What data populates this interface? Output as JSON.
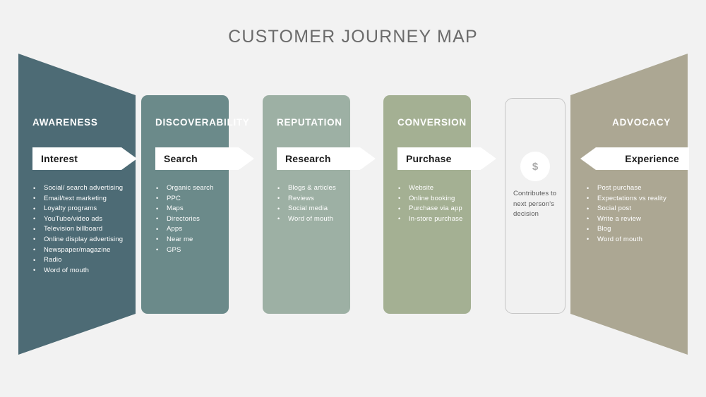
{
  "title": "CUSTOMER JOURNEY MAP",
  "colors": {
    "background": "#f2f2f2",
    "title_text": "#6b6b6b",
    "awareness": "#4d6b75",
    "discoverability": "#6b8a8a",
    "reputation": "#9db0a4",
    "conversion": "#a4b093",
    "advocacy": "#aca793",
    "contributes_card": "#f1f1f1",
    "contributes_border": "#c6c6c6",
    "banner": "#ffffff",
    "banner_text": "#1c1c1c",
    "body_text": "#ffffff",
    "dollar_glyph": "#a9a9a9",
    "contributes_text": "#5a5a5a"
  },
  "stages": [
    {
      "id": "awareness",
      "heading": "AWARENESS",
      "banner_label": "Interest",
      "banner_direction": "right",
      "items": [
        "Social/ search advertising",
        "Email/text marketing",
        "Loyalty programs",
        "YouTube/video ads",
        "Television billboard",
        "Online display advertising",
        "Newspaper/magazine",
        "Radio",
        "Word of mouth"
      ]
    },
    {
      "id": "discoverability",
      "heading": "DISCOVERABILITY",
      "banner_label": "Search",
      "banner_direction": "right",
      "items": [
        "Organic search",
        "PPC",
        "Maps",
        "Directories",
        "Apps",
        "Near me",
        "GPS"
      ]
    },
    {
      "id": "reputation",
      "heading": "REPUTATION",
      "banner_label": "Research",
      "banner_direction": "right",
      "items": [
        "Blogs & articles",
        "Reviews",
        "Social media",
        "Word of mouth"
      ]
    },
    {
      "id": "conversion",
      "heading": "CONVERSION",
      "banner_label": "Purchase",
      "banner_direction": "right",
      "items": [
        "Website",
        "Online booking",
        "Purchase via app",
        "In-store purchase"
      ]
    },
    {
      "id": "advocacy",
      "heading": "ADVOCACY",
      "banner_label": "Experience",
      "banner_direction": "left",
      "items": [
        "Post purchase",
        "Expectations vs reality",
        "Social post",
        "Write a review",
        "Blog",
        "Word of mouth"
      ]
    }
  ],
  "contributes_card": {
    "icon": "dollar-sign-icon",
    "icon_glyph": "$",
    "text": "Contributes to next person's decision"
  }
}
